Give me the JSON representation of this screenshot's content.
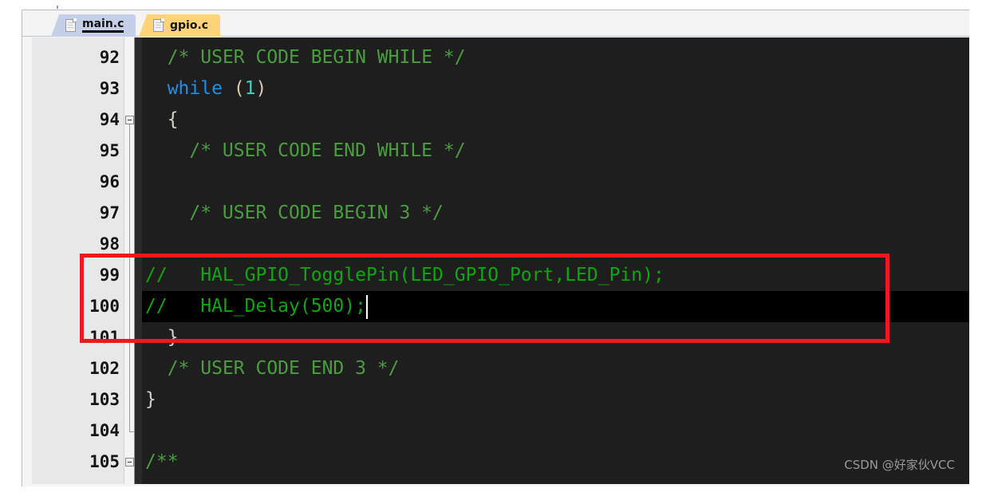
{
  "window": {
    "title": ""
  },
  "tabs": [
    {
      "label": "main.c",
      "icon": "file-icon",
      "active": true,
      "color": "#c5cfe8"
    },
    {
      "label": "gpio.c",
      "icon": "file-icon",
      "active": false,
      "color": "#ffd479"
    }
  ],
  "editor": {
    "background": "#1e1e1e",
    "gutter_background": "#e8e8e8",
    "current_line_background": "#000000",
    "first_line": 92,
    "last_line": 105,
    "current_line": 100,
    "fold_markers": [
      94,
      105
    ],
    "colors": {
      "block_comment": "#4a9e3f",
      "line_comment": "#0fa60f",
      "keyword": "#1e90e6",
      "brace": "#cfd4c8",
      "paren": "#d9c9a8",
      "number": "#3fd0c0",
      "annotation": "#f01818"
    },
    "lines": [
      {
        "number": "92",
        "text": "  /* USER CODE BEGIN WHILE */"
      },
      {
        "number": "93",
        "text": "  while (1)"
      },
      {
        "number": "94",
        "text": "  {"
      },
      {
        "number": "95",
        "text": "    /* USER CODE END WHILE */"
      },
      {
        "number": "96",
        "text": ""
      },
      {
        "number": "97",
        "text": "    /* USER CODE BEGIN 3 */"
      },
      {
        "number": "98",
        "text": ""
      },
      {
        "number": "99",
        "text": "//   HAL_GPIO_TogglePin(LED_GPIO_Port,LED_Pin);"
      },
      {
        "number": "100",
        "text": "//   HAL_Delay(500);"
      },
      {
        "number": "101",
        "text": "  }"
      },
      {
        "number": "102",
        "text": "  /* USER CODE END 3 */"
      },
      {
        "number": "103",
        "text": "}"
      },
      {
        "number": "104",
        "text": ""
      },
      {
        "number": "105",
        "text": "/**"
      }
    ]
  },
  "annotation": {
    "type": "red-rectangle",
    "covers_lines": "99-100",
    "color": "#f01818"
  },
  "watermark": {
    "text": "CSDN @好家伙VCC"
  }
}
